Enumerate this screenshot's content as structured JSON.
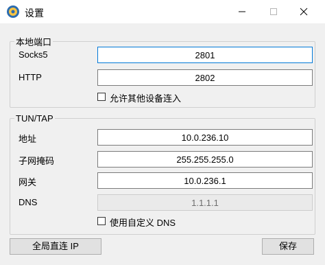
{
  "window": {
    "title": "设置",
    "icon": "network-gear-icon"
  },
  "local_ports": {
    "legend": "本地端口",
    "socks5_label": "Socks5",
    "socks5_value": "2801",
    "http_label": "HTTP",
    "http_value": "2802",
    "allow_other_devices_label": "允许其他设备连入",
    "allow_other_devices_checked": false
  },
  "tuntap": {
    "legend": "TUN/TAP",
    "address_label": "地址",
    "address_value": "10.0.236.10",
    "netmask_label": "子网掩码",
    "netmask_value": "255.255.255.0",
    "gateway_label": "网关",
    "gateway_value": "10.0.236.1",
    "dns_label": "DNS",
    "dns_value": "1.1.1.1",
    "custom_dns_label": "使用自定义 DNS",
    "custom_dns_checked": false
  },
  "buttons": {
    "global_direct_ip": "全局直连 IP",
    "save": "保存"
  }
}
